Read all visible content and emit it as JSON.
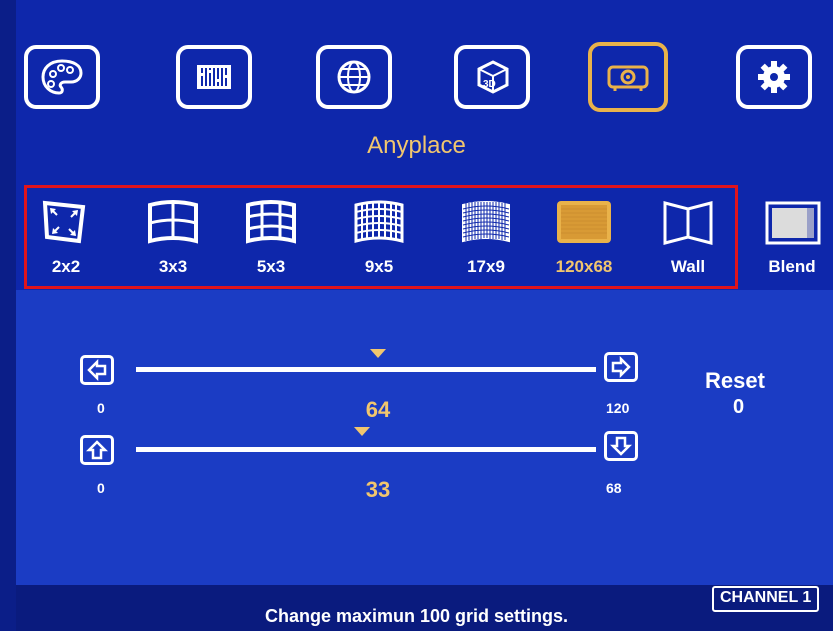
{
  "menu": {
    "categories": [
      {
        "name": "palette-icon",
        "active": false
      },
      {
        "name": "sliders-icon",
        "active": false
      },
      {
        "name": "globe-icon",
        "active": false
      },
      {
        "name": "3d-icon",
        "active": false
      },
      {
        "name": "projector-icon",
        "active": true
      },
      {
        "name": "gear-icon",
        "active": false
      }
    ],
    "section_title": "Anyplace"
  },
  "grid_modes": {
    "items": [
      {
        "label": "2x2",
        "icon": "grid-2x2-icon",
        "selected": false
      },
      {
        "label": "3x3",
        "icon": "grid-3x3-icon",
        "selected": false
      },
      {
        "label": "5x3",
        "icon": "grid-5x3-icon",
        "selected": false
      },
      {
        "label": "9x5",
        "icon": "grid-9x5-icon",
        "selected": false
      },
      {
        "label": "17x9",
        "icon": "grid-17x9-icon",
        "selected": false
      },
      {
        "label": "120x68",
        "icon": "grid-120x68-icon",
        "selected": true
      },
      {
        "label": "Wall",
        "icon": "wall-icon",
        "selected": false
      },
      {
        "label": "Blend",
        "icon": "blend-icon",
        "selected": false
      }
    ]
  },
  "sliders": {
    "horizontal": {
      "min": "0",
      "max": "120",
      "value": "64"
    },
    "vertical": {
      "min": "0",
      "max": "68",
      "value": "33"
    }
  },
  "reset": {
    "label": "Reset",
    "value": "0"
  },
  "footer": {
    "channel": "CHANNEL 1",
    "status": "Change maximun 100 grid settings."
  },
  "colors": {
    "accent": "#f1c66e",
    "background": "#1b3cc4",
    "highlight_box": "#e0141b"
  }
}
